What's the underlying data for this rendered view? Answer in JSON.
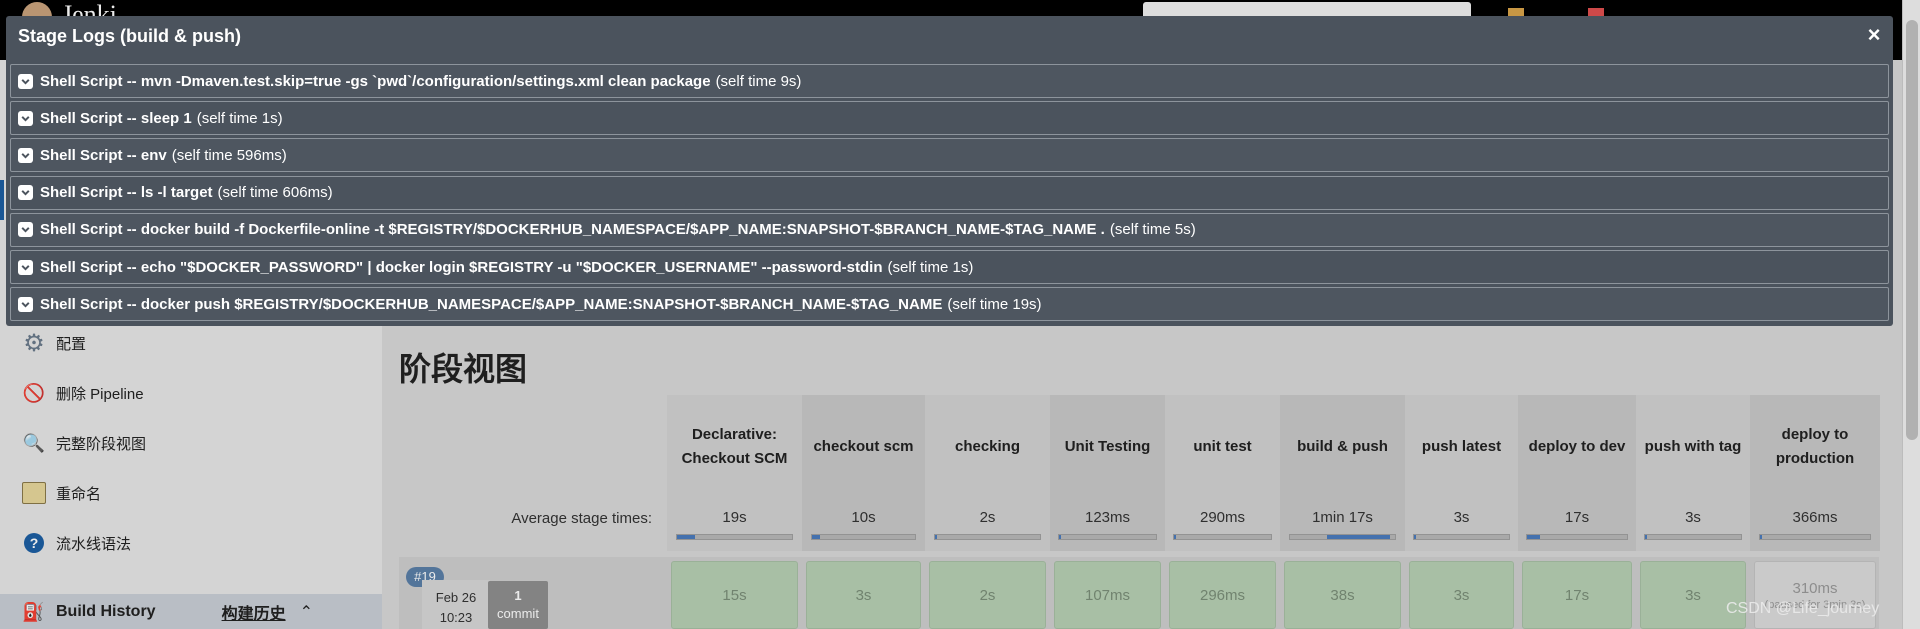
{
  "header": {
    "brand_partial": "Jenki"
  },
  "sidebar": {
    "items": [
      {
        "label": "配置",
        "icon": "gear-icon"
      },
      {
        "label": "删除 Pipeline",
        "icon": "delete-icon"
      },
      {
        "label": "完整阶段视图",
        "icon": "search-icon"
      },
      {
        "label": "重命名",
        "icon": "notepad-icon"
      },
      {
        "label": "流水线语法",
        "icon": "help-icon"
      }
    ],
    "build_history": {
      "label": "Build History",
      "link": "构建历史",
      "icon": "build-history-icon"
    }
  },
  "main": {
    "title": "阶段视图",
    "avg_label": "Average stage times:",
    "stages": [
      {
        "name": "Declarative: Checkout SCM",
        "avg": "19s",
        "avg_fraction": 0.15
      },
      {
        "name": "checkout scm",
        "avg": "10s",
        "avg_fraction": 0.08
      },
      {
        "name": "checking",
        "avg": "2s",
        "avg_fraction": 0.02
      },
      {
        "name": "Unit Testing",
        "avg": "123ms",
        "avg_fraction": 0.01
      },
      {
        "name": "unit test",
        "avg": "290ms",
        "avg_fraction": 0.01
      },
      {
        "name": "build & push",
        "avg": "1min 17s",
        "avg_fraction": 0.6
      },
      {
        "name": "push latest",
        "avg": "3s",
        "avg_fraction": 0.02
      },
      {
        "name": "deploy to dev",
        "avg": "17s",
        "avg_fraction": 0.13
      },
      {
        "name": "push with tag",
        "avg": "3s",
        "avg_fraction": 0.02
      },
      {
        "name": "deploy to production",
        "avg": "366ms",
        "avg_fraction": 0.01
      }
    ],
    "run": {
      "badge": "#19",
      "date": "Feb 26",
      "time": "10:23",
      "commit_count": "1",
      "commit_label": "commit",
      "cells": [
        "15s",
        "3s",
        "2s",
        "107ms",
        "296ms",
        "38s",
        "3s",
        "17s",
        "3s",
        "310ms"
      ],
      "last_cell_note": "(paused for 3min 3s)"
    }
  },
  "modal": {
    "title": "Stage Logs (build & push)",
    "close": "×",
    "logs": [
      {
        "command": "Shell Script -- mvn -Dmaven.test.skip=true -gs `pwd`/configuration/settings.xml clean package",
        "time": "(self time 9s)"
      },
      {
        "command": "Shell Script -- sleep 1",
        "time": "(self time 1s)"
      },
      {
        "command": "Shell Script -- env",
        "time": "(self time 596ms)"
      },
      {
        "command": "Shell Script -- ls -l target",
        "time": "(self time 606ms)"
      },
      {
        "command": "Shell Script -- docker build -f Dockerfile-online -t $REGISTRY/$DOCKERHUB_NAMESPACE/$APP_NAME:SNAPSHOT-$BRANCH_NAME-$TAG_NAME .",
        "time": "(self time 5s)"
      },
      {
        "command": "Shell Script -- echo \"$DOCKER_PASSWORD\" | docker login $REGISTRY -u \"$DOCKER_USERNAME\" --password-stdin",
        "time": "(self time 1s)"
      },
      {
        "command": "Shell Script -- docker push $REGISTRY/$DOCKERHUB_NAMESPACE/$APP_NAME:SNAPSHOT-$BRANCH_NAME-$TAG_NAME",
        "time": "(self time 19s)"
      }
    ]
  },
  "watermark": "CSDN @Life_journey",
  "colors": {
    "modal_bg": "#4b535d",
    "success_cell": "#b7d0b4",
    "accent_blue": "#4a7bbd"
  }
}
